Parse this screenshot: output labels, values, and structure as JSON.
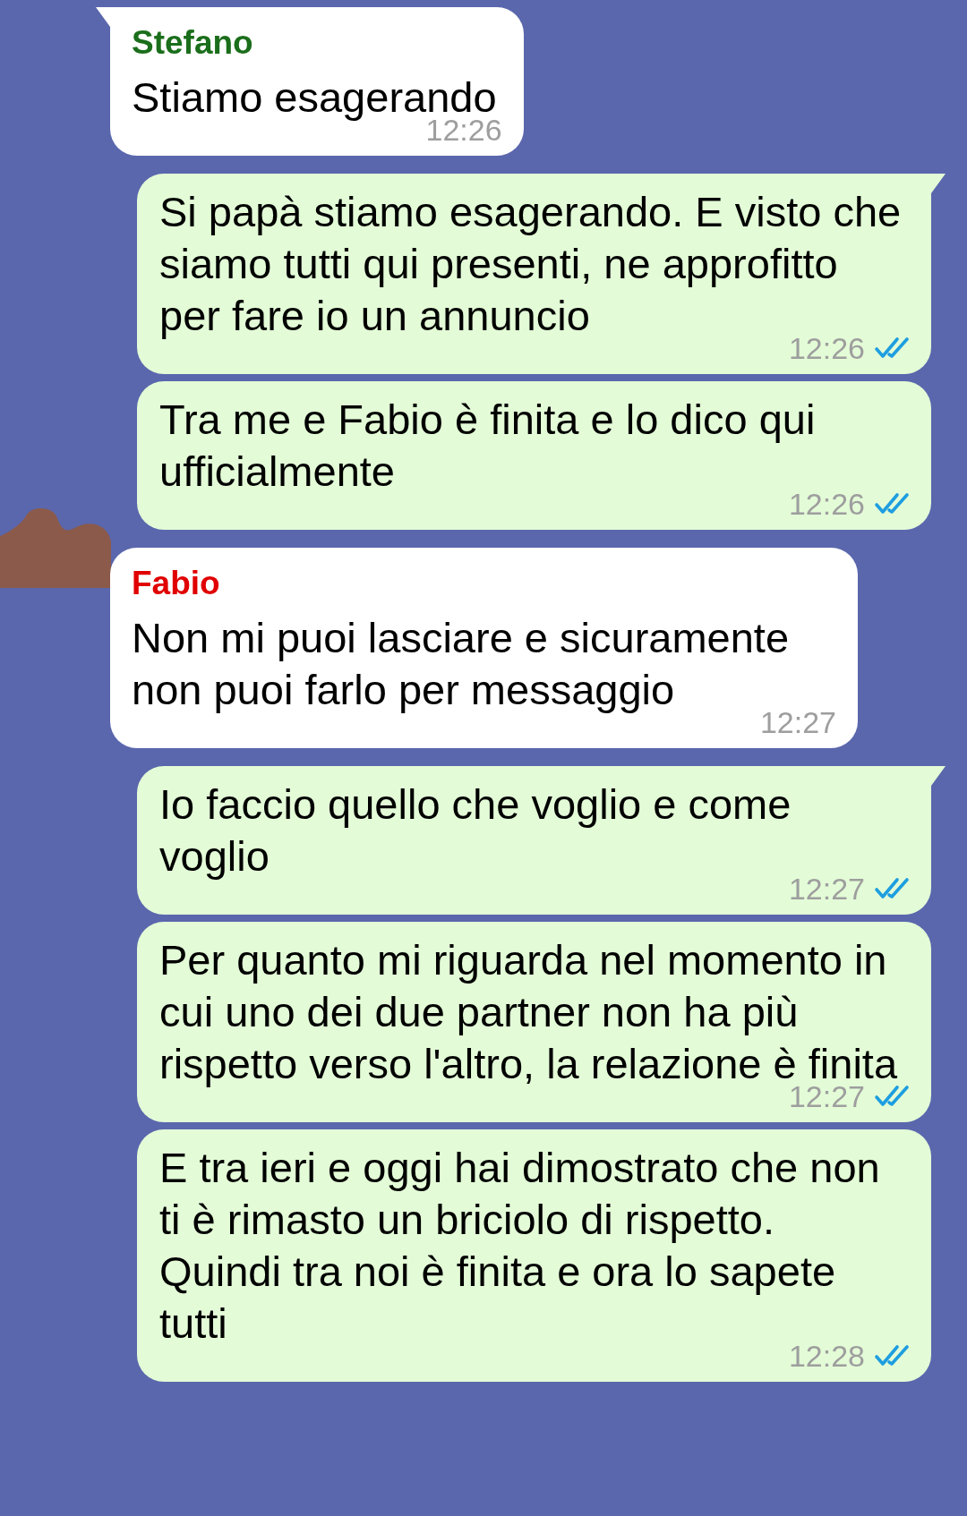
{
  "messages": [
    {
      "kind": "incoming",
      "tail": true,
      "avatar_redacted": false,
      "sender": "Stefano",
      "color": "#1b6e1b",
      "text": "Stiamo esagerando",
      "time": "12:26"
    },
    {
      "kind": "outgoing",
      "tail": true,
      "text": "Si papà stiamo esagerando. E visto che siamo tutti qui presenti, ne approfitto per fare io un annuncio",
      "time": "12:26",
      "read": true
    },
    {
      "kind": "outgoing",
      "tail": false,
      "text": "Tra me e Fabio è finita e lo dico qui ufficialmente",
      "time": "12:26",
      "read": true
    },
    {
      "kind": "incoming",
      "tail": false,
      "avatar_redacted": true,
      "sender": "Fabio",
      "color": "#e00000",
      "text": "Non mi puoi lasciare e sicuramente non puoi farlo per messaggio",
      "time": "12:27"
    },
    {
      "kind": "outgoing",
      "tail": true,
      "text": "Io faccio quello che voglio e come voglio",
      "time": "12:27",
      "read": true
    },
    {
      "kind": "outgoing",
      "tail": false,
      "text": "Per quanto mi riguarda nel momento in cui uno dei due partner non ha più rispetto verso l'altro, la relazione è finita",
      "time": "12:27",
      "read": true
    },
    {
      "kind": "outgoing",
      "tail": false,
      "text": "E tra ieri e oggi hai dimostrato che non ti è rimasto un briciolo di rispetto. Quindi tra noi è finita e ora lo sapete tutti",
      "time": "12:28",
      "read": true
    }
  ]
}
